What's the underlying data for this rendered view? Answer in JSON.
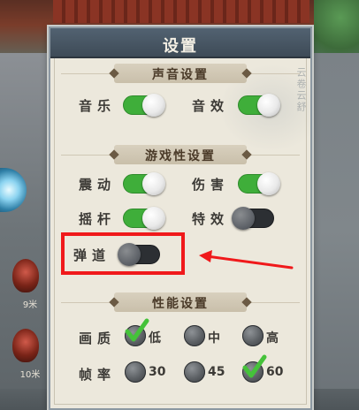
{
  "panel": {
    "title": "设置"
  },
  "sound": {
    "title": "声音设置",
    "music": {
      "label": "音乐",
      "on": true
    },
    "sfx": {
      "label": "音效",
      "on": true
    }
  },
  "gameplay": {
    "title": "游戏性设置",
    "vibration": {
      "label": "震动",
      "on": true
    },
    "damage": {
      "label": "伤害",
      "on": true
    },
    "joystick": {
      "label": "摇杆",
      "on": true
    },
    "effects": {
      "label": "特效",
      "on": false
    },
    "ballistic": {
      "label": "弹道",
      "on": false
    }
  },
  "performance": {
    "title": "性能设置",
    "quality": {
      "label": "画质",
      "options": [
        "低",
        "中",
        "高"
      ],
      "selected": "低"
    },
    "framerate": {
      "label": "帧率",
      "options": [
        "30",
        "45",
        "60"
      ],
      "selected": "60"
    }
  },
  "background": {
    "left_labels": [
      "9米",
      "10米"
    ]
  },
  "annotation": {
    "highlight_color": "#f0191b"
  },
  "colors": {
    "toggle_on": "#3fae3a",
    "toggle_off": "#2c2f33",
    "header": "#3e4b57"
  }
}
